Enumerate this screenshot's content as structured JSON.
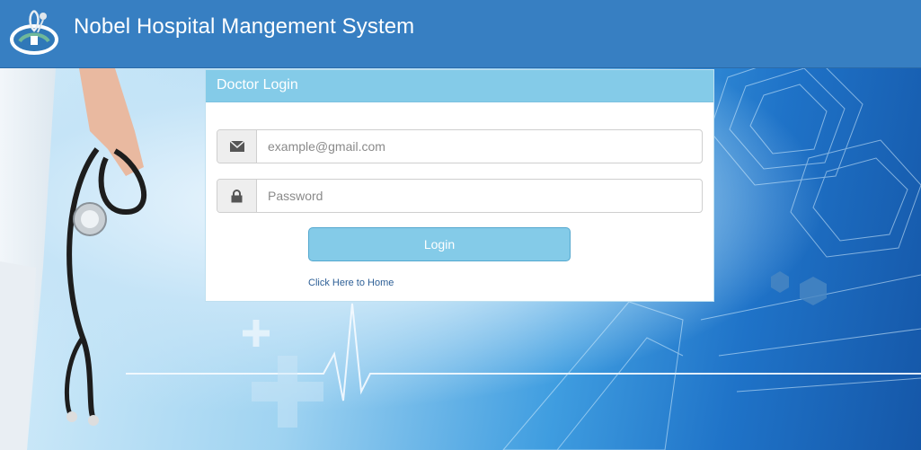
{
  "header": {
    "title": "Nobel Hospital Mangement System",
    "logo_icon": "stethoscope-logo-icon"
  },
  "login": {
    "heading": "Doctor Login",
    "email": {
      "placeholder": "example@gmail.com",
      "value": "",
      "icon": "envelope-icon"
    },
    "password": {
      "placeholder": "Password",
      "value": "",
      "icon": "lock-icon"
    },
    "submit_label": "Login",
    "home_link": "Click Here to Home"
  },
  "colors": {
    "header_bg": "#377fc2",
    "panel_heading_bg": "#84cbe8",
    "button_bg": "#84cbe8",
    "link": "#2d5f96"
  }
}
